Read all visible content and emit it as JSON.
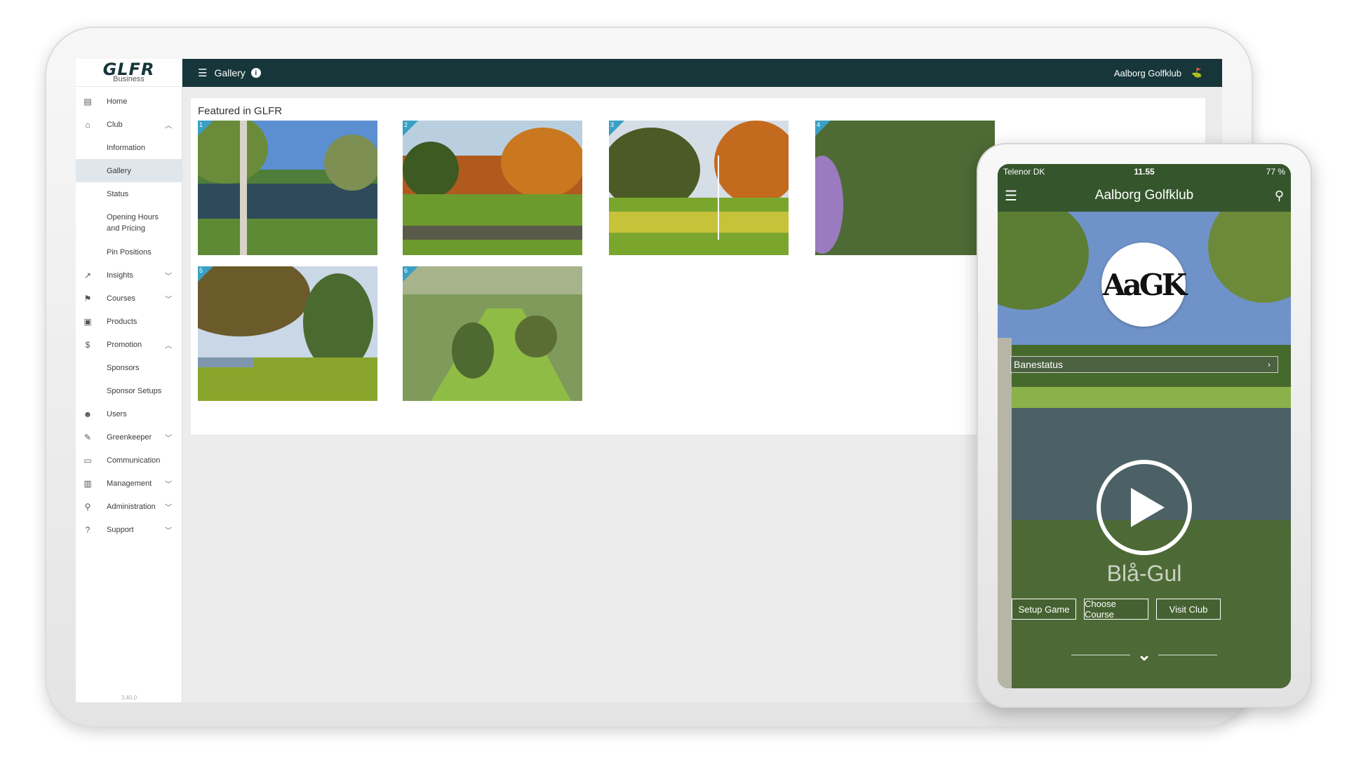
{
  "sidebar": {
    "logo": "GLFR",
    "logo_sub": "Business",
    "version": "3.40.0",
    "items": [
      {
        "label": "Home",
        "icon": "building-icon"
      },
      {
        "label": "Club",
        "icon": "bank-icon"
      },
      {
        "label": "Information"
      },
      {
        "label": "Gallery"
      },
      {
        "label": "Status"
      },
      {
        "label": "Opening Hours and Pricing"
      },
      {
        "label": "Pin Positions"
      },
      {
        "label": "Insights",
        "icon": "trend-icon"
      },
      {
        "label": "Courses",
        "icon": "flag-icon"
      },
      {
        "label": "Products",
        "icon": "products-icon"
      },
      {
        "label": "Promotion",
        "icon": "dollar-icon"
      },
      {
        "label": "Sponsors"
      },
      {
        "label": "Sponsor Setups"
      },
      {
        "label": "Users",
        "icon": "users-icon"
      },
      {
        "label": "Greenkeeper",
        "icon": "wrench-icon"
      },
      {
        "label": "Communication",
        "icon": "message-icon"
      },
      {
        "label": "Management",
        "icon": "clipboard-icon"
      },
      {
        "label": "Administration",
        "icon": "person-icon"
      },
      {
        "label": "Support",
        "icon": "help-icon"
      }
    ]
  },
  "topbar": {
    "title": "Gallery",
    "club": "Aalborg Golfklub"
  },
  "gallery": {
    "title": "Featured in GLFR",
    "images": [
      "1",
      "2",
      "3",
      "4",
      "5",
      "6"
    ]
  },
  "phone": {
    "carrier": "Telenor DK",
    "time": "11.55",
    "battery": "77 %",
    "app_title": "Aalborg Golfklub",
    "club_logo": "AaGK",
    "course_status": "Banestatus",
    "course_name": "Blå-Gul",
    "buttons": {
      "setup": "Setup Game",
      "choose": "Choose Course",
      "visit": "Visit Club"
    }
  },
  "colors": {
    "topbar": "#16363a",
    "accent": "#3a9fc4",
    "phone_green": "#35562d"
  }
}
